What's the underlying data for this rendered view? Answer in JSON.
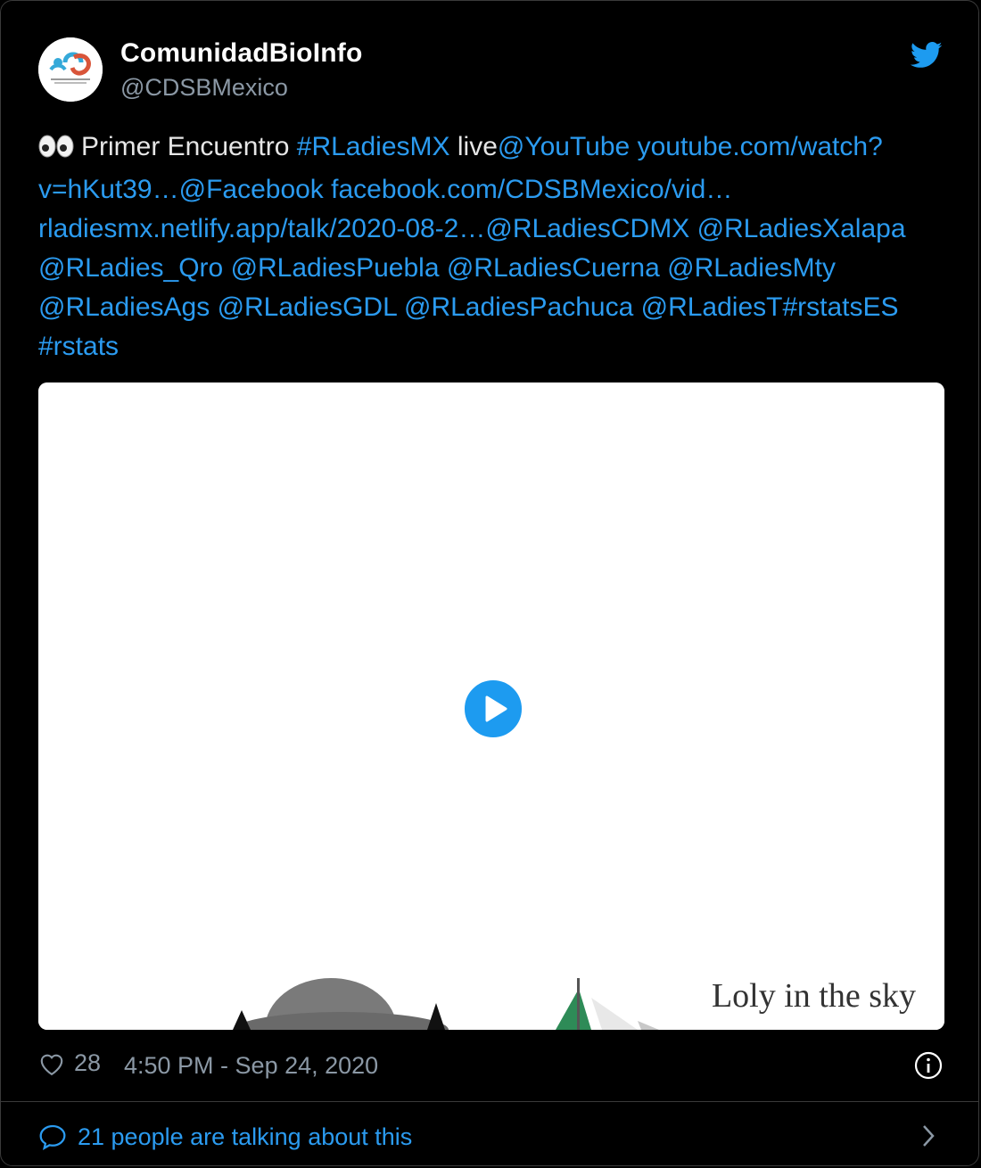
{
  "account": {
    "name": "ComunidadBioInfo",
    "handle": "@CDSBMexico"
  },
  "tweet": {
    "segments": [
      {
        "text": "Primer Encuentro ",
        "type": "text"
      },
      {
        "text": "#RLadiesMX",
        "type": "link"
      },
      {
        "text": " live",
        "type": "text"
      },
      {
        "text": "@YouTube",
        "type": "link"
      },
      {
        "text": " ",
        "type": "text"
      },
      {
        "text": "youtube.com/watch?v=hKut39…",
        "type": "link"
      },
      {
        "text": "@Facebook",
        "type": "link"
      },
      {
        "text": " ",
        "type": "text"
      },
      {
        "text": "facebook.com/CDSBMexico/vid…",
        "type": "link"
      },
      {
        "text": " ",
        "type": "text"
      },
      {
        "text": "rladiesmx.netlify.app/talk/2020-08-2…",
        "type": "link"
      },
      {
        "text": "@RLadiesCDMX",
        "type": "link"
      },
      {
        "text": " ",
        "type": "text"
      },
      {
        "text": "@RLadiesXalapa",
        "type": "link"
      },
      {
        "text": " ",
        "type": "text"
      },
      {
        "text": "@RLadies_Qro",
        "type": "link"
      },
      {
        "text": " ",
        "type": "text"
      },
      {
        "text": "@RLadiesPuebla",
        "type": "link"
      },
      {
        "text": " ",
        "type": "text"
      },
      {
        "text": "@RLadiesCuerna",
        "type": "link"
      },
      {
        "text": " ",
        "type": "text"
      },
      {
        "text": "@RLadiesMty",
        "type": "link"
      },
      {
        "text": " ",
        "type": "text"
      },
      {
        "text": "@RLadiesAgs",
        "type": "link"
      },
      {
        "text": " ",
        "type": "text"
      },
      {
        "text": "@RLadiesGDL",
        "type": "link"
      },
      {
        "text": " ",
        "type": "text"
      },
      {
        "text": "@RLadiesPachuca",
        "type": "link"
      },
      {
        "text": " ",
        "type": "text"
      },
      {
        "text": "@RLadiesT",
        "type": "link"
      },
      {
        "text": "#rstatsES",
        "type": "link"
      },
      {
        "text": " ",
        "type": "text"
      },
      {
        "text": "#rstats",
        "type": "link"
      }
    ],
    "media_caption": "Loly in the sky"
  },
  "footer": {
    "like_count": "28",
    "timestamp": "4:50 PM - Sep 24, 2020",
    "talking": "21 people are talking about this"
  },
  "colors": {
    "link": "#2b9bf0",
    "background": "#000000",
    "muted": "#8b98a5"
  },
  "icons": [
    "eyes-emoji",
    "twitter-bird-icon",
    "play-icon",
    "heart-icon",
    "info-icon",
    "speech-bubble-icon",
    "chevron-right-icon"
  ]
}
